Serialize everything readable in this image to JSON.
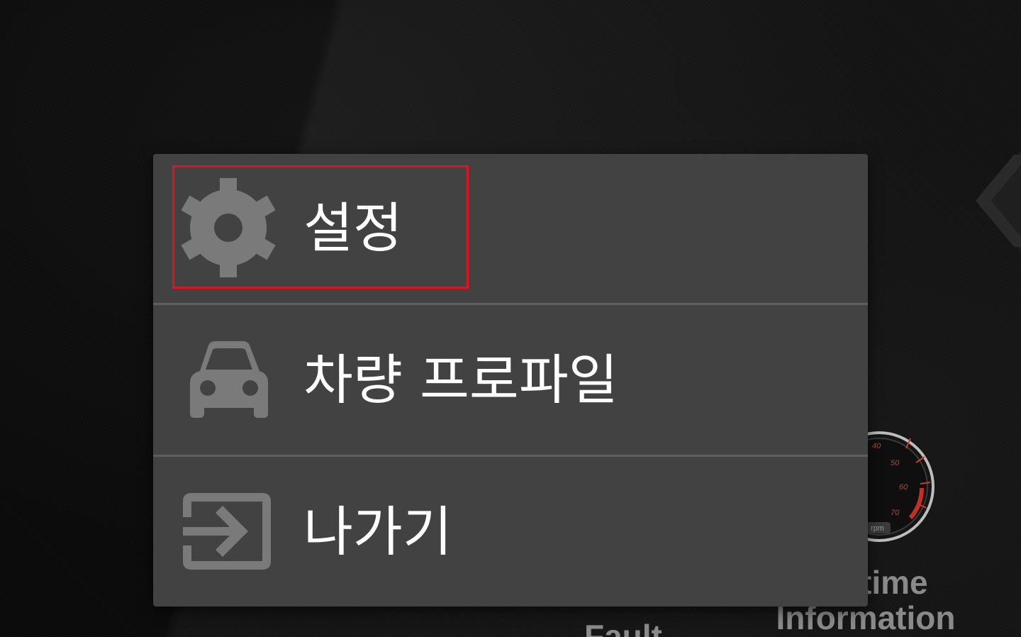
{
  "menu": {
    "items": [
      {
        "label": "설정",
        "icon": "gear-icon"
      },
      {
        "label": "차량 프로파일",
        "icon": "car-icon"
      },
      {
        "label": "나가기",
        "icon": "exit-icon"
      }
    ],
    "highlighted_index": 0,
    "highlight_color": "#e0141e"
  },
  "background": {
    "realtime_label_line1": "time",
    "realtime_label_line2": "Information",
    "fault_label": "Fault",
    "gauge": {
      "ticks": [
        "40",
        "50",
        "60",
        "70"
      ],
      "unit": "rpm"
    }
  },
  "colors": {
    "dialog_bg": "#424242",
    "divider": "#5e5e5e",
    "icon": "#7a7a7a",
    "text": "#ffffff",
    "gauge_accent": "#c8401e"
  }
}
